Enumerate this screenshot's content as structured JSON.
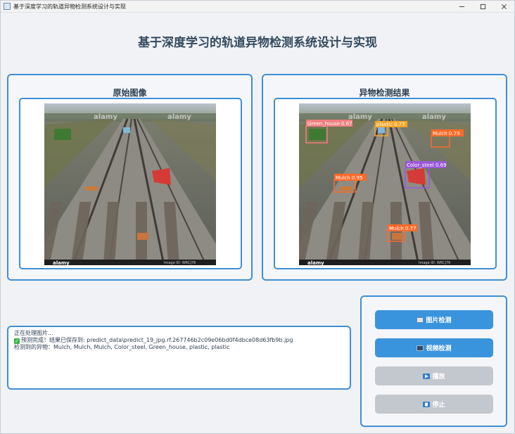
{
  "window": {
    "title": "基于深度学习的轨道异物检测系统设计与实现"
  },
  "header": {
    "title": "基于深度学习的轨道异物检测系统设计与实现"
  },
  "panels": {
    "original": {
      "title": "原始图像"
    },
    "result": {
      "title": "异物检测结果"
    }
  },
  "photo": {
    "watermark": "alamy",
    "footer_logo": "alamy",
    "image_id": "Image ID: W6CJ76"
  },
  "detections": [
    {
      "label": "Green_house 0.67",
      "color": "#f08080"
    },
    {
      "label": "plastic 0.77",
      "color": "#f5a623"
    },
    {
      "label": "Mulch 0.79",
      "color": "#ff6a2a"
    },
    {
      "label": "Color_steel 0.69",
      "color": "#9b59d9"
    },
    {
      "label": "Mulch 0.95",
      "color": "#ff6a2a"
    },
    {
      "label": "Mulch 0.77",
      "color": "#ff6a2a"
    }
  ],
  "log": {
    "line1": "正在处理图片...",
    "line2": "预测完成！结果已保存到: predict_data\\predict_19_jpg.rf.267746b2c09e06bd0f4dbce08d63fb9b.jpg",
    "line3": "检测到的异物：Mulch, Mulch, Mulch, Color_steel, Green_house, plastic, plastic"
  },
  "controls": {
    "image_detect": "图片检测",
    "video_detect": "视频检测",
    "play": "播放",
    "stop": "停止"
  },
  "icons": {
    "minimize": "minimize-icon",
    "maximize": "maximize-icon",
    "close": "close-icon"
  }
}
